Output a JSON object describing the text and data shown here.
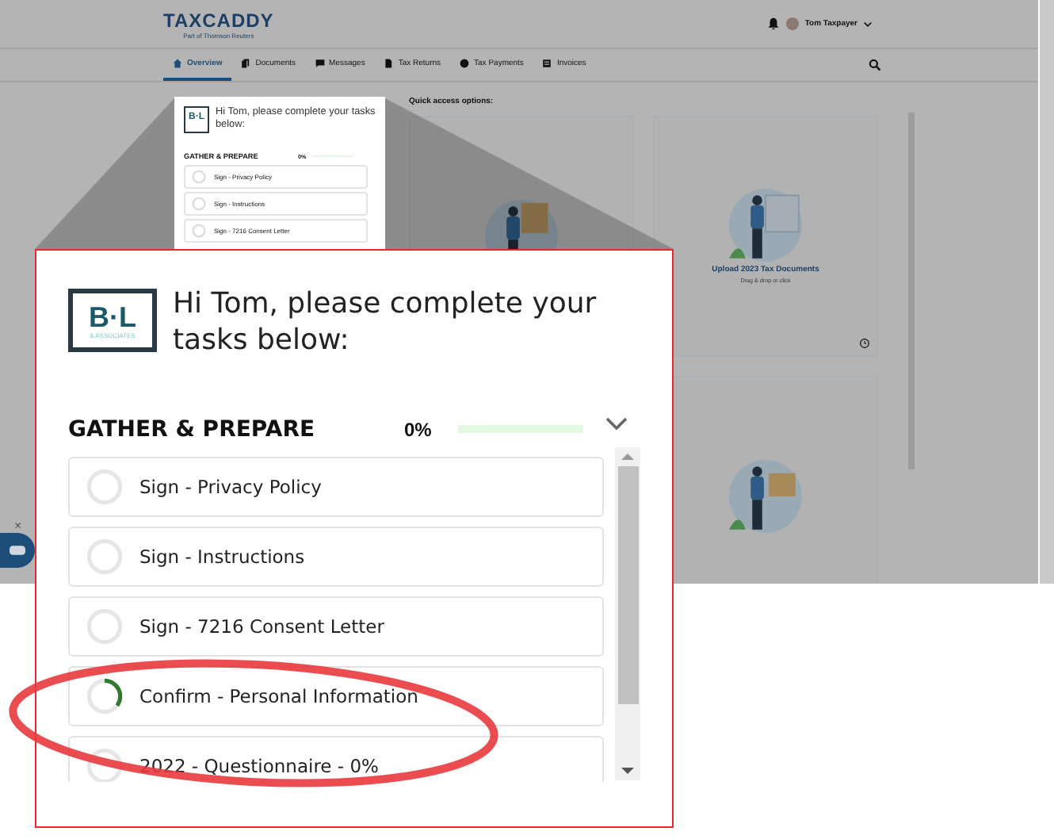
{
  "header": {
    "logo": "TAXCADDY",
    "logo_subtitle": "Part of Thomson Reuters",
    "user": "Tom Taxpayer"
  },
  "nav": [
    {
      "label": "Overview",
      "selected": true,
      "kind": "home"
    },
    {
      "label": "Documents",
      "selected": false,
      "kind": "documents"
    },
    {
      "label": "Messages",
      "selected": false,
      "kind": "messages"
    },
    {
      "label": "Tax Returns",
      "selected": false,
      "kind": "returns"
    },
    {
      "label": "Tax Payments",
      "selected": false,
      "kind": "payments"
    },
    {
      "label": "Invoices",
      "selected": false,
      "kind": "invoices"
    }
  ],
  "mini_card": {
    "logo": "B·L",
    "greeting": "Hi Tom, please complete your tasks below:",
    "section": "GATHER & PREPARE",
    "percent": "0%",
    "level": 0,
    "tasks": [
      {
        "label": "Sign - Privacy Policy",
        "level": 0
      },
      {
        "label": "Sign - Instructions",
        "level": 0
      },
      {
        "label": "Sign - 7216 Consent Letter",
        "level": 0
      }
    ]
  },
  "quick_access": {
    "title": "Quick access options:",
    "cards": [
      {
        "kind": "folder"
      },
      {
        "kind": "upload",
        "title": "Upload 2023 Tax Documents",
        "subtitle": "Drag & drop or click"
      },
      {
        "kind": "board"
      }
    ]
  },
  "callout": {
    "logo": "B·L",
    "logo_subtitle": "& ASSOCIATES",
    "greeting": "Hi Tom, please complete your tasks below:",
    "section": "GATHER & PREPARE",
    "percent": "0%",
    "level": 0,
    "tasks": [
      {
        "label": "Sign - Privacy Policy",
        "level": 0
      },
      {
        "label": "Sign - Instructions",
        "level": 0
      },
      {
        "label": "Sign - 7216 Consent Letter",
        "level": 0
      },
      {
        "label": "Confirm - Personal Information",
        "level": 0.35
      },
      {
        "label": "2022 - Questionnaire - 0%",
        "level": 0
      }
    ]
  },
  "chat": {
    "close": "×"
  }
}
